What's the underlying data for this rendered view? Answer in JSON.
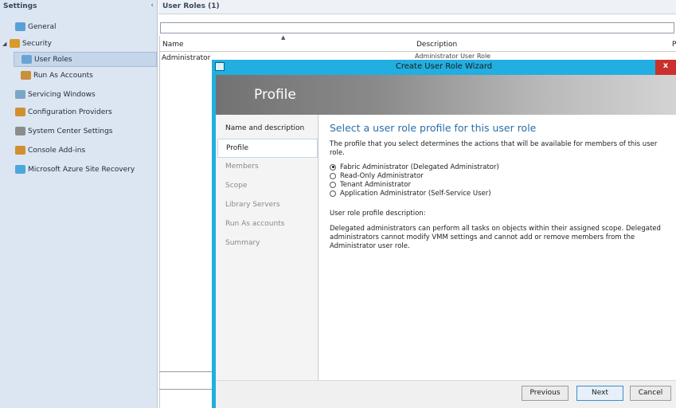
{
  "nav": {
    "header": "Settings",
    "collapse_glyph": "‹",
    "items": [
      {
        "label": "General",
        "icon": "settings-icon",
        "color": "#5aa0d8",
        "indent": 1,
        "expander": ""
      },
      {
        "label": "Security",
        "icon": "security-icon",
        "color": "#d79b2b",
        "indent": 0,
        "expander": "◢"
      },
      {
        "label": "User Roles",
        "icon": "user-roles-icon",
        "color": "#6aa4d6",
        "indent": 2,
        "expander": "",
        "selected": true
      },
      {
        "label": "Run As Accounts",
        "icon": "run-as-accounts-icon",
        "color": "#c98f3a",
        "indent": 2,
        "expander": ""
      },
      {
        "label": "Servicing Windows",
        "icon": "servicing-windows-icon",
        "color": "#7aa7c7",
        "indent": 1,
        "expander": ""
      },
      {
        "label": "Configuration Providers",
        "icon": "configuration-providers-icon",
        "color": "#d0902f",
        "indent": 1,
        "expander": ""
      },
      {
        "label": "System Center Settings",
        "icon": "system-center-settings-icon",
        "color": "#8c8c8c",
        "indent": 1,
        "expander": ""
      },
      {
        "label": "Console Add-ins",
        "icon": "console-addins-icon",
        "color": "#d0902f",
        "indent": 1,
        "expander": ""
      },
      {
        "label": "Microsoft Azure Site Recovery",
        "icon": "azure-site-recovery-icon",
        "color": "#4aa8dc",
        "indent": 1,
        "expander": ""
      }
    ]
  },
  "main": {
    "header": "User Roles (1)",
    "columns": {
      "name": "Name",
      "description": "Description",
      "extra": "P"
    },
    "rows": [
      {
        "name": "Administrator",
        "description": "Administrator User Role"
      }
    ]
  },
  "dialog": {
    "title": "Create User Role Wizard",
    "close_glyph": "x",
    "banner_title": "Profile",
    "steps": [
      "Name and description",
      "Profile",
      "Members",
      "Scope",
      "Library Servers",
      "Run As accounts",
      "Summary"
    ],
    "current_step": 1,
    "heading": "Select a user role profile for this user role",
    "intro": "The profile that you select determines the actions that will be available for members of this user role.",
    "options": [
      {
        "label": "Fabric Administrator (Delegated Administrator)",
        "selected": true
      },
      {
        "label": "Read-Only Administrator",
        "selected": false
      },
      {
        "label": "Tenant Administrator",
        "selected": false
      },
      {
        "label": "Application Administrator (Self-Service User)",
        "selected": false
      }
    ],
    "description_label": "User role profile description:",
    "description_text": "Delegated administrators can perform all tasks on objects within their assigned scope. Delegated administrators cannot modify VMM settings and cannot add or remove members from the Administrator user role.",
    "buttons": {
      "previous": "Previous",
      "next": "Next",
      "cancel": "Cancel"
    }
  },
  "colors": {
    "accent": "#22aee0",
    "heading": "#2a6ea8",
    "close": "#c9312c"
  }
}
